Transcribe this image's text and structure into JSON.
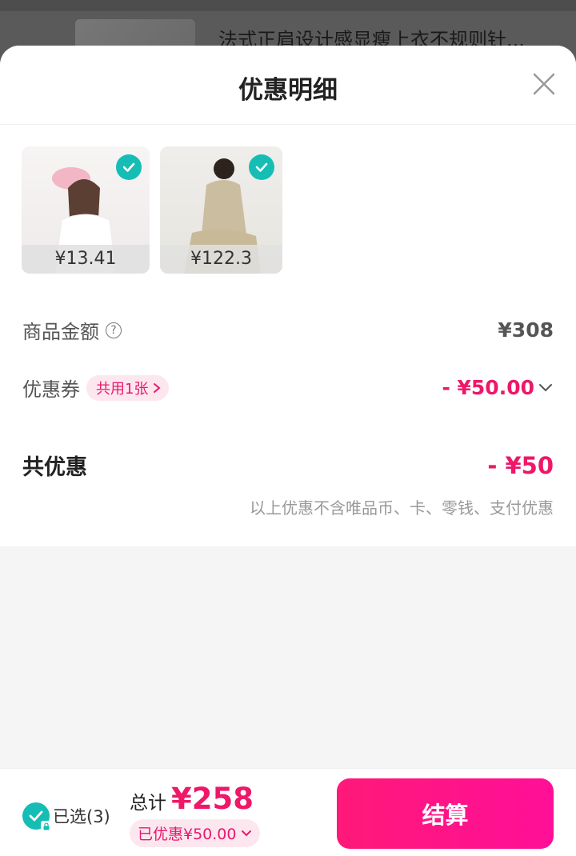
{
  "background": {
    "item_title": "法式正肩设计感显瘦上衣不规则针..."
  },
  "sheet": {
    "title": "优惠明细",
    "products": [
      {
        "price": "¥13.41",
        "checked": true
      },
      {
        "price": "¥122.3",
        "checked": true
      }
    ],
    "goods_amount": {
      "label": "商品金额",
      "value": "¥308"
    },
    "coupon": {
      "label": "优惠券",
      "tag": "共用1张",
      "value": "- ¥50.00"
    },
    "total_discount": {
      "label": "共优惠",
      "value": "- ¥50"
    },
    "note": "以上优惠不含唯品币、卡、零钱、支付优惠"
  },
  "bottom_bar": {
    "selected_label": "已选(3)",
    "total_label": "总计",
    "total_amount": "¥258",
    "discount_label": "已优惠¥50.00",
    "checkout_label": "结算"
  },
  "colors": {
    "accent": "#ee1768",
    "check": "#16bdb5"
  }
}
